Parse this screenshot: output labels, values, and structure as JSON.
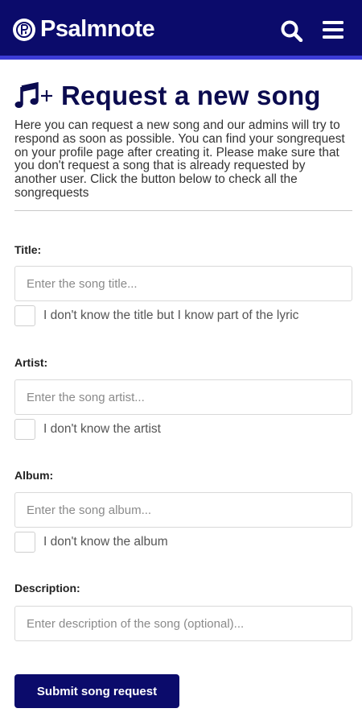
{
  "header": {
    "brand_name": "Psalmnote",
    "logo_icon": "psalmnote-logo-icon",
    "search_icon": "search-icon",
    "menu_icon": "hamburger-menu-icon",
    "background_color": "#0b0b6b",
    "accent_color": "#3b3bd6"
  },
  "page": {
    "title": "Request a new song",
    "title_icon": "music-note-plus-icon",
    "intro": "Here you can request a new song and our admins will try to respond as soon as possible. You can find your songrequest on your profile page after creating it. Please make sure that you don't request a song that is already requested by another user. Click the button below to check all the songrequests"
  },
  "form": {
    "title": {
      "label": "Title:",
      "placeholder": "Enter the song title...",
      "value": "",
      "checkbox_label": "I don't know the title but I know part of the lyric",
      "checked": false
    },
    "artist": {
      "label": "Artist:",
      "placeholder": "Enter the song artist...",
      "value": "",
      "checkbox_label": "I don't know the artist",
      "checked": false
    },
    "album": {
      "label": "Album:",
      "placeholder": "Enter the song album...",
      "value": "",
      "checkbox_label": "I don't know the album",
      "checked": false
    },
    "description": {
      "label": "Description:",
      "placeholder": "Enter description of the song (optional)...",
      "value": ""
    },
    "submit_label": "Submit song request"
  }
}
